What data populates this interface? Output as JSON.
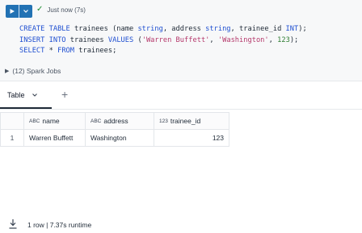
{
  "status": {
    "text": "Just now (7s)"
  },
  "code": {
    "line1": [
      "CREATE TABLE",
      " trainees (name ",
      "string",
      ", address ",
      "string",
      ", trainee_id ",
      "INT",
      ");"
    ],
    "line2": [
      "INSERT INTO",
      " trainees ",
      "VALUES",
      " (",
      "'Warren Buffett'",
      ", ",
      "'Washington'",
      ", ",
      "123",
      ");"
    ],
    "line3": [
      "SELECT",
      " * ",
      "FROM",
      " trainees;"
    ]
  },
  "jobs": {
    "label": "(12) Spark Jobs"
  },
  "tabs": {
    "active": "Table",
    "add": "+"
  },
  "table": {
    "columns": [
      {
        "type": "ABC",
        "name": "name"
      },
      {
        "type": "ABC",
        "name": "address"
      },
      {
        "type": "123",
        "name": "trainee_id"
      }
    ],
    "rows": [
      {
        "index": "1",
        "name": "Warren Buffett",
        "address": "Washington",
        "trainee_id": "123"
      }
    ]
  },
  "footer": {
    "text": "1 row  |  7.37s runtime"
  },
  "colors": {
    "run": "#2272b4",
    "success": "#1a8c2e"
  }
}
